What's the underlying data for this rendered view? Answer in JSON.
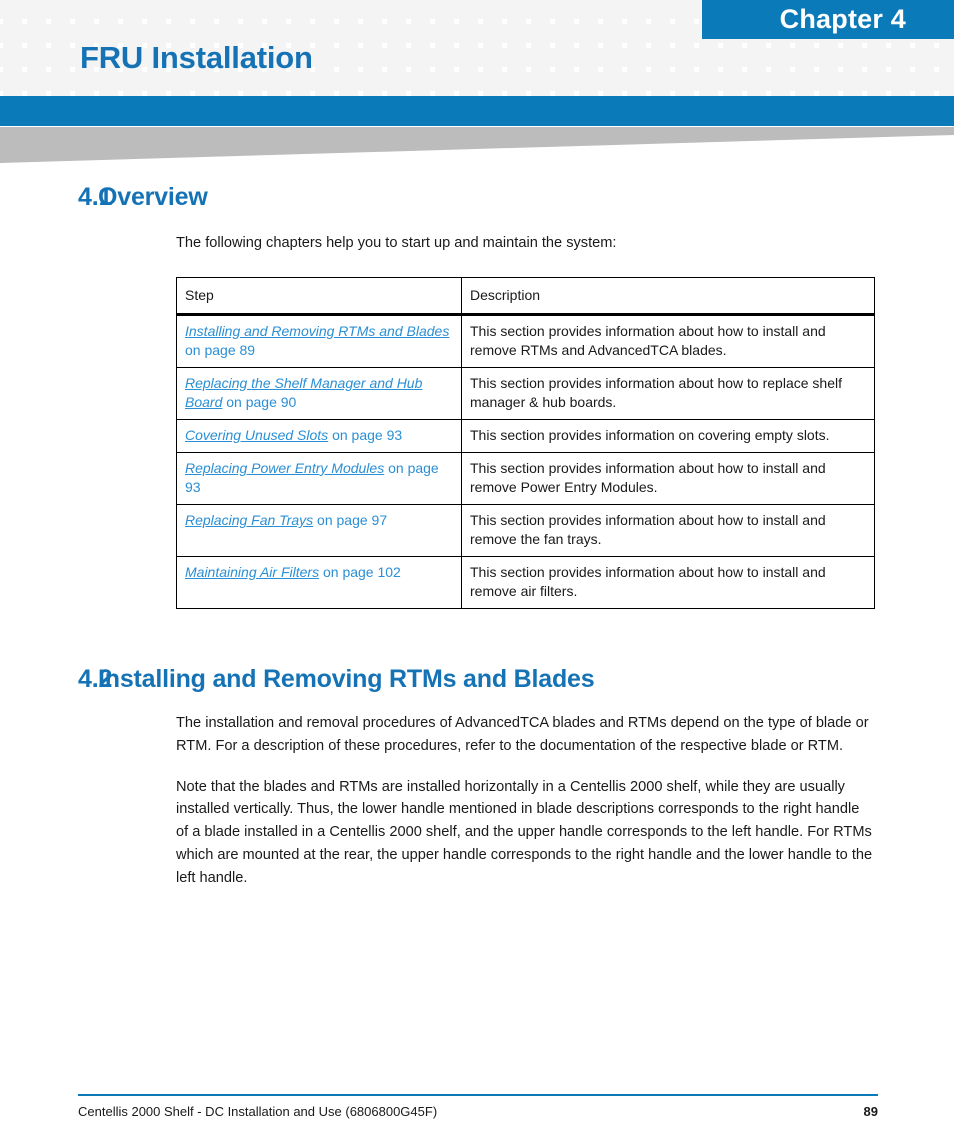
{
  "header": {
    "chapter_label": "Chapter 4",
    "chapter_title": "FRU Installation",
    "accent_color": "#0b7ab8",
    "title_color": "#1573b5",
    "pattern_color": "#f4f4f4",
    "wedge_color": "#bcbcbc"
  },
  "sections": {
    "overview": {
      "number": "4.1",
      "title": "Overview",
      "intro": "The following chapters help you to start up and maintain the system:"
    },
    "installing": {
      "number": "4.2",
      "title": "Installing and Removing RTMs and Blades",
      "paragraph_1": "The installation and removal procedures of AdvancedTCA blades and RTMs depend on the type of blade or RTM. For a description of these procedures, refer to the documentation of the respective blade or RTM.",
      "paragraph_2": "Note that the blades and RTMs are installed horizontally in a Centellis 2000 shelf, while they are usually installed vertically. Thus, the lower handle mentioned in blade descriptions corresponds to the right handle of a blade installed in a Centellis 2000 shelf, and the upper handle corresponds to the left handle. For RTMs which are mounted at the rear, the upper handle corresponds to the right handle and the lower handle to the left handle."
    }
  },
  "table": {
    "columns": [
      "Step",
      "Description"
    ],
    "rows": [
      {
        "link": "Installing and Removing RTMs and Blades",
        "page_ref": "on page 89",
        "description": "This section provides information about how to install and remove RTMs and AdvancedTCA blades."
      },
      {
        "link": "Replacing the Shelf Manager and Hub Board",
        "page_ref": "on page 90",
        "description": "This section provides information about how to replace shelf manager & hub boards."
      },
      {
        "link": "Covering Unused Slots",
        "page_ref": "on page 93",
        "description": "This section provides information on covering empty slots."
      },
      {
        "link": "Replacing Power Entry Modules",
        "page_ref": "on page 93",
        "description": "This section provides information about how to install and remove Power Entry Modules."
      },
      {
        "link": "Replacing Fan Trays",
        "page_ref": "on page 97",
        "description": "This section provides information about how to install and remove the fan trays."
      },
      {
        "link": "Maintaining Air Filters",
        "page_ref": "on page 102",
        "description": "This section provides information about how to install and remove air filters."
      }
    ]
  },
  "footer": {
    "document_title": "Centellis 2000 Shelf - DC Installation and Use (6806800G45F)",
    "page_number": "89"
  }
}
